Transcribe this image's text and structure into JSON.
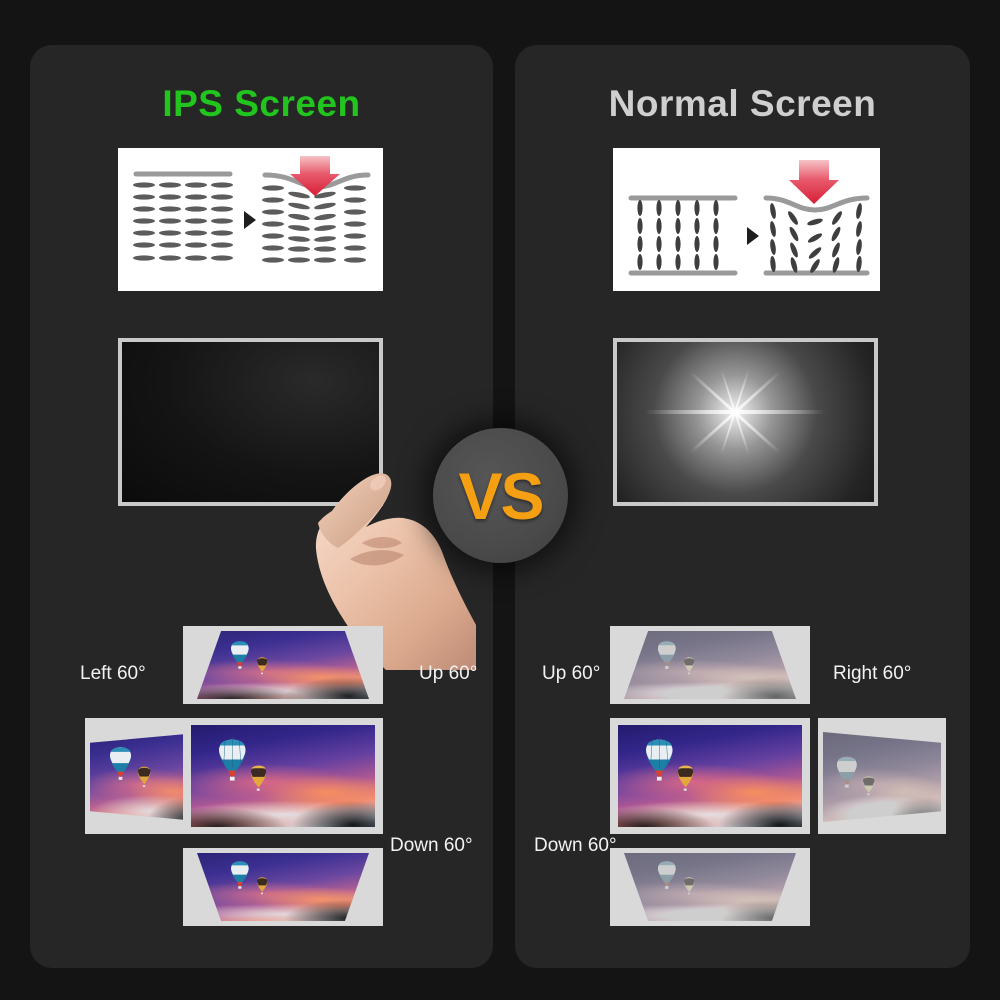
{
  "page": {
    "background_color": "#141414",
    "panel_color": "#262626"
  },
  "panels": [
    {
      "id": "ips",
      "title": "IPS Screen",
      "title_color": "#22c51e",
      "press_diagram": {
        "name": "ips-pressure-diagram",
        "description": "horizontal liquid crystal alignment before and after pressure",
        "arrow_color": "#e0304a"
      },
      "touch_demo": {
        "name": "ips-touch-monitor",
        "screen_state": "no ripple, uniform dark screen"
      },
      "viewing_angles": {
        "left": "Left 60°",
        "up": "Up 60°",
        "down": "Down 60°",
        "quality": "vivid"
      }
    },
    {
      "id": "normal",
      "title": "Normal Screen",
      "title_color": "#cfcfcf",
      "press_diagram": {
        "name": "normal-pressure-diagram",
        "description": "vertical liquid crystal alignment distorted by pressure",
        "arrow_color": "#e0304a"
      },
      "touch_demo": {
        "name": "normal-touch-monitor",
        "screen_state": "bright starburst ripple under finger"
      },
      "viewing_angles": {
        "up": "Up 60°",
        "right": "Right 60°",
        "down": "Down 60°",
        "quality": "washed out"
      }
    }
  ],
  "vs_badge": {
    "label": "VS",
    "text_color": "#f5a012",
    "circle_color": "#4a4a4a"
  }
}
